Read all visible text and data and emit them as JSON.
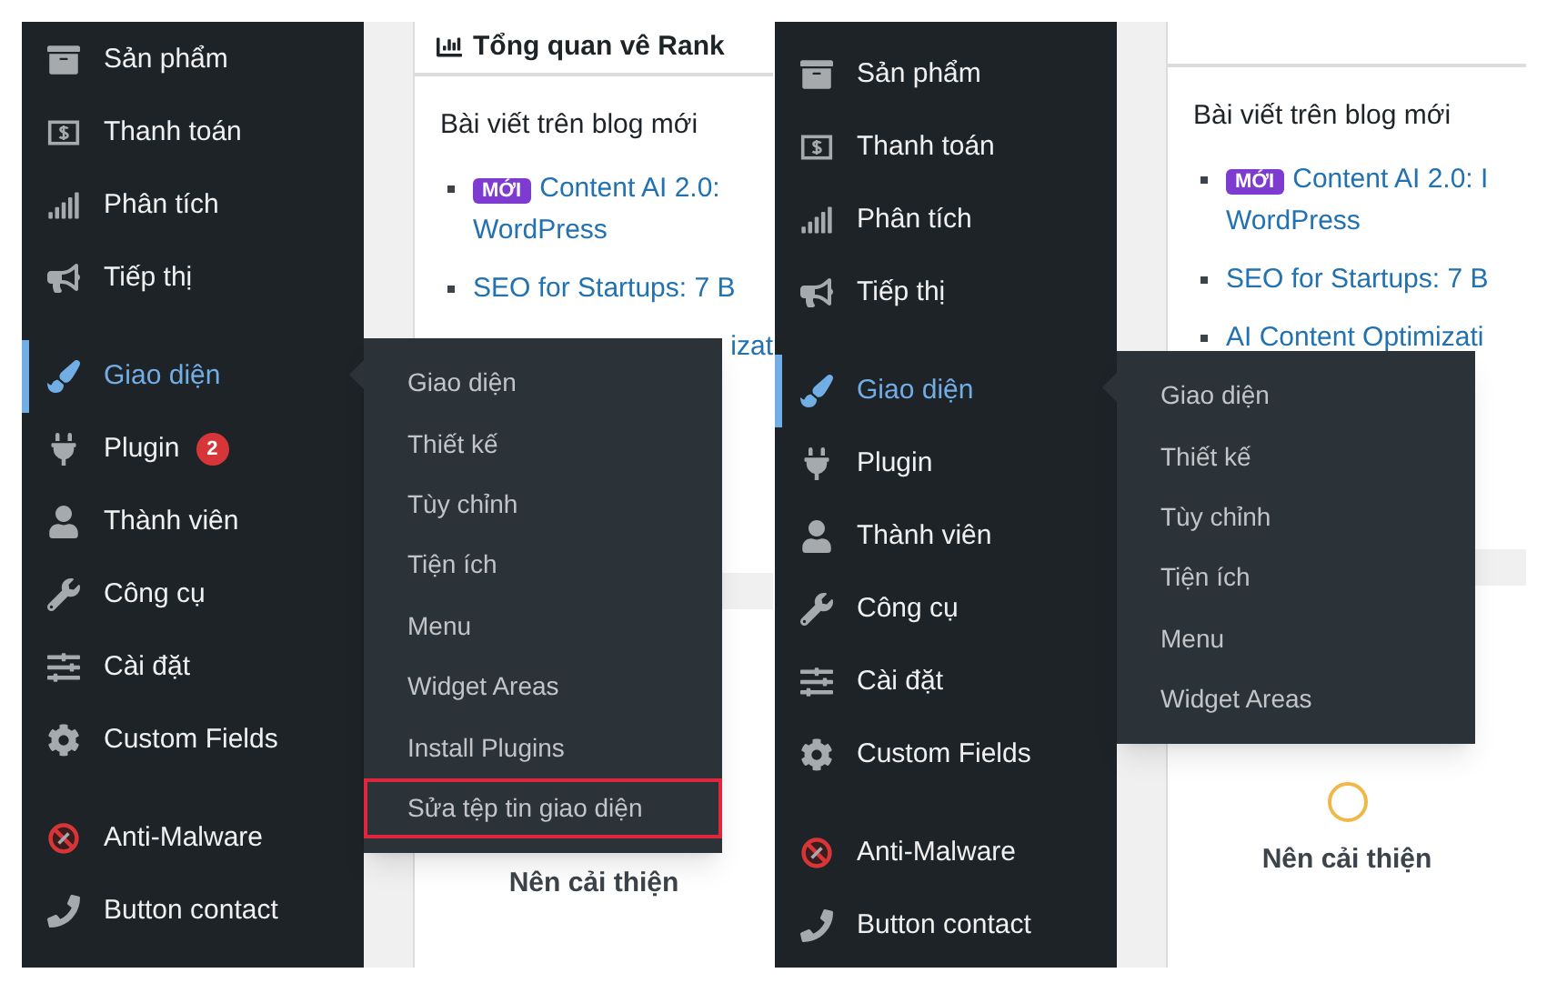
{
  "panels": [
    {
      "menu": [
        {
          "label": "Sản phẩm",
          "selected": false
        },
        {
          "label": "Thanh toán",
          "selected": false
        },
        {
          "label": "Phân tích",
          "selected": false
        },
        {
          "label": "Tiếp thị",
          "selected": false
        },
        {
          "label": "Giao diện",
          "selected": true
        },
        {
          "label": "Plugin",
          "selected": false,
          "badge": "2"
        },
        {
          "label": "Thành viên",
          "selected": false
        },
        {
          "label": "Công cụ",
          "selected": false
        },
        {
          "label": "Cài đặt",
          "selected": false
        },
        {
          "label": "Custom Fields",
          "selected": false
        },
        {
          "label": "Anti-Malware",
          "selected": false
        },
        {
          "label": "Button contact",
          "selected": false
        }
      ],
      "flyout": [
        {
          "label": "Giao diện",
          "highlighted": false
        },
        {
          "label": "Thiết kế",
          "highlighted": false
        },
        {
          "label": "Tùy chỉnh",
          "highlighted": false
        },
        {
          "label": "Tiện ích",
          "highlighted": false
        },
        {
          "label": "Menu",
          "highlighted": false
        },
        {
          "label": "Widget Areas",
          "highlighted": false
        },
        {
          "label": "Install Plugins",
          "highlighted": false
        },
        {
          "label": "Sửa tệp tin giao diện",
          "highlighted": true
        }
      ],
      "content": {
        "header": "Tổng quan vê Rank",
        "section_title": "Bài viết trên blog mới",
        "posts": [
          {
            "kind": "full",
            "badge": "MỚI",
            "lines": [
              "Content AI 2.0:",
              "WordPress"
            ]
          },
          {
            "kind": "full",
            "lines": [
              "SEO for Startups: 7 B"
            ]
          },
          {
            "kind": "fragment",
            "lines": [
              "izat"
            ]
          }
        ],
        "score_ring": false,
        "status": "Nên cải thiện"
      }
    },
    {
      "menu": [
        {
          "label": "Sản phẩm",
          "selected": false
        },
        {
          "label": "Thanh toán",
          "selected": false
        },
        {
          "label": "Phân tích",
          "selected": false
        },
        {
          "label": "Tiếp thị",
          "selected": false
        },
        {
          "label": "Giao diện",
          "selected": true
        },
        {
          "label": "Plugin",
          "selected": false
        },
        {
          "label": "Thành viên",
          "selected": false
        },
        {
          "label": "Công cụ",
          "selected": false
        },
        {
          "label": "Cài đặt",
          "selected": false
        },
        {
          "label": "Custom Fields",
          "selected": false
        },
        {
          "label": "Anti-Malware",
          "selected": false
        },
        {
          "label": "Button contact",
          "selected": false
        }
      ],
      "flyout": [
        {
          "label": "Giao diện",
          "highlighted": false
        },
        {
          "label": "Thiết kế",
          "highlighted": false
        },
        {
          "label": "Tùy chỉnh",
          "highlighted": false
        },
        {
          "label": "Tiện ích",
          "highlighted": false
        },
        {
          "label": "Menu",
          "highlighted": false
        },
        {
          "label": "Widget Areas",
          "highlighted": false
        }
      ],
      "content": {
        "section_title": "Bài viết trên blog mới",
        "posts": [
          {
            "kind": "full",
            "badge": "MỚI",
            "lines": [
              "Content AI 2.0: I",
              "WordPress"
            ]
          },
          {
            "kind": "full",
            "lines": [
              "SEO for Startups: 7 B"
            ]
          },
          {
            "kind": "full",
            "lines": [
              "AI Content Optimizati"
            ]
          }
        ],
        "score_ring": true,
        "status": "Nên cải thiện"
      }
    }
  ]
}
